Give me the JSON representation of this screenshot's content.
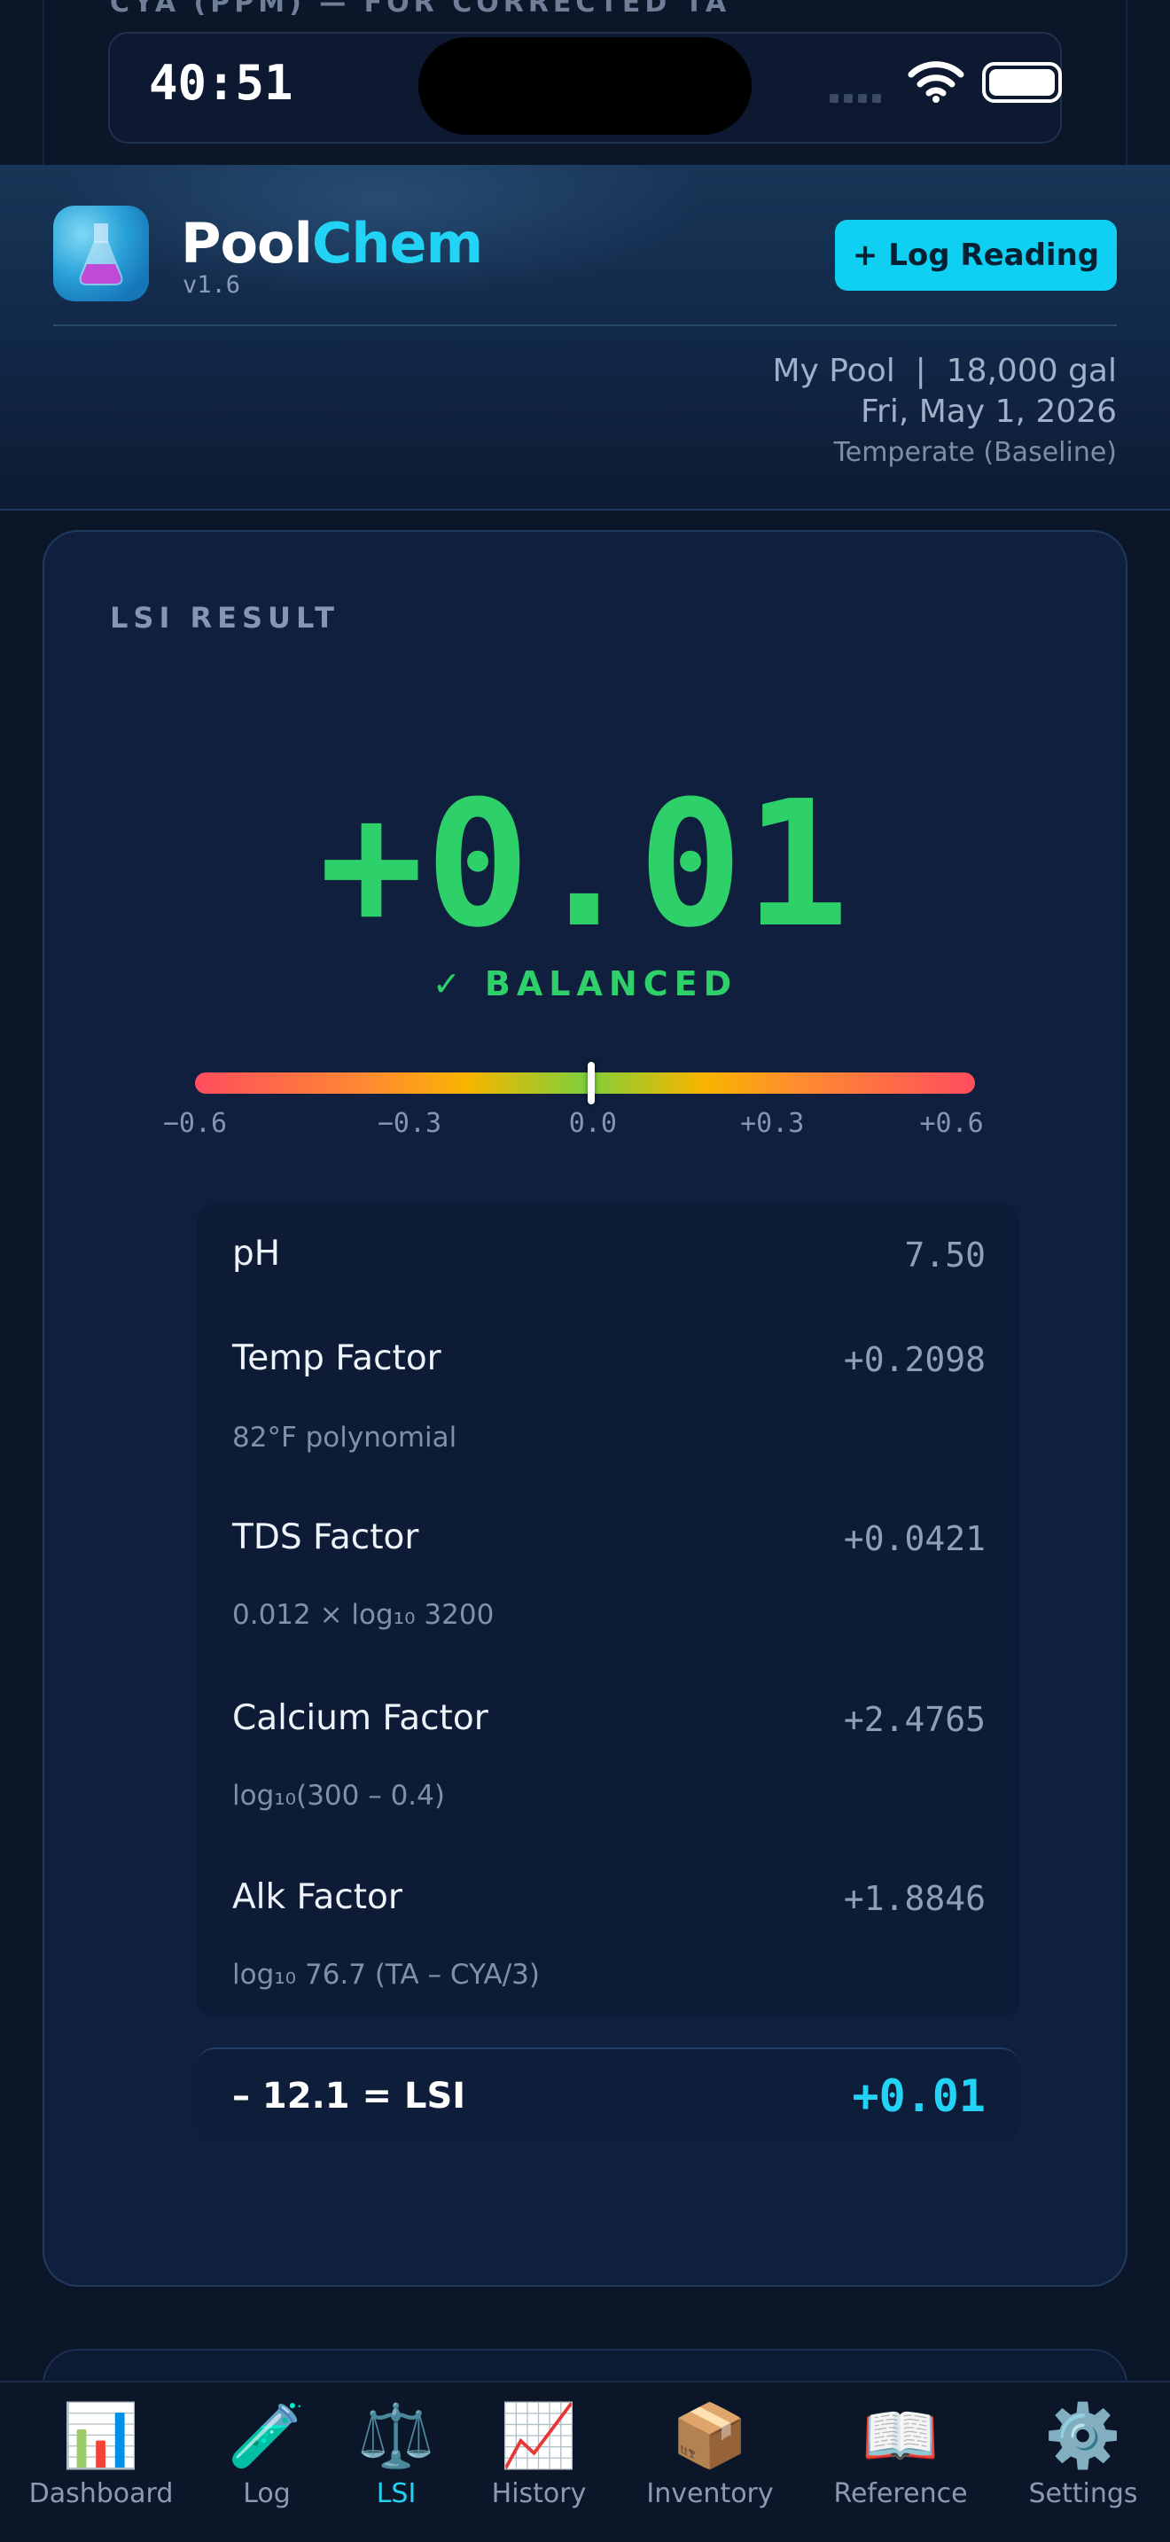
{
  "section_cut_label": "CYA (PPM) — FOR CORRECTED TA",
  "status_bar": {
    "time": "40:51"
  },
  "header": {
    "app_name_part1": "Pool",
    "app_name_part2": "Chem",
    "version": "v1.6",
    "log_button": "+ Log Reading",
    "pool_summary": "My Pool  |  18,000 gal",
    "date": "Fri, May 1, 2026",
    "climate": "Temperate (Baseline)"
  },
  "lsi_card": {
    "title": "LSI RESULT",
    "value": "+0.01",
    "status": "✓ BALANCED",
    "scale": {
      "min": -0.6,
      "max": 0.6,
      "marker_value": 0.01,
      "ticks": [
        "−0.6",
        "−0.3",
        "0.0",
        "+0.3",
        "+0.6"
      ]
    },
    "factors": [
      {
        "label": "pH",
        "value": "7.50",
        "note": ""
      },
      {
        "label": "Temp Factor",
        "value": "+0.2098",
        "note": "82°F polynomial"
      },
      {
        "label": "TDS Factor",
        "value": "+0.0421",
        "note": "0.012 × log₁₀ 3200"
      },
      {
        "label": "Calcium Factor",
        "value": "+2.4765",
        "note": "log₁₀(300 – 0.4)"
      },
      {
        "label": "Alk Factor",
        "value": "+1.8846",
        "note": "log₁₀ 76.7 (TA – CYA/3)"
      }
    ],
    "total": {
      "label": "– 12.1 = LSI",
      "value": "+0.01"
    }
  },
  "bottom_nav": [
    {
      "label": "Dashboard",
      "icon": "📊",
      "icon_name": "bar-chart-icon",
      "active": false
    },
    {
      "label": "Log",
      "icon": "🧪",
      "icon_name": "test-tube-icon",
      "active": false
    },
    {
      "label": "LSI",
      "icon": "⚖️",
      "icon_name": "balance-scale-icon",
      "active": true
    },
    {
      "label": "History",
      "icon": "📈",
      "icon_name": "trend-chart-icon",
      "active": false
    },
    {
      "label": "Inventory",
      "icon": "📦",
      "icon_name": "package-icon",
      "active": false
    },
    {
      "label": "Reference",
      "icon": "📖",
      "icon_name": "open-book-icon",
      "active": false
    },
    {
      "label": "Settings",
      "icon": "⚙️",
      "icon_name": "gear-icon",
      "active": false
    }
  ],
  "colors": {
    "accent": "#22d3f5",
    "balanced": "#2ed06a",
    "background": "#0b1629"
  }
}
